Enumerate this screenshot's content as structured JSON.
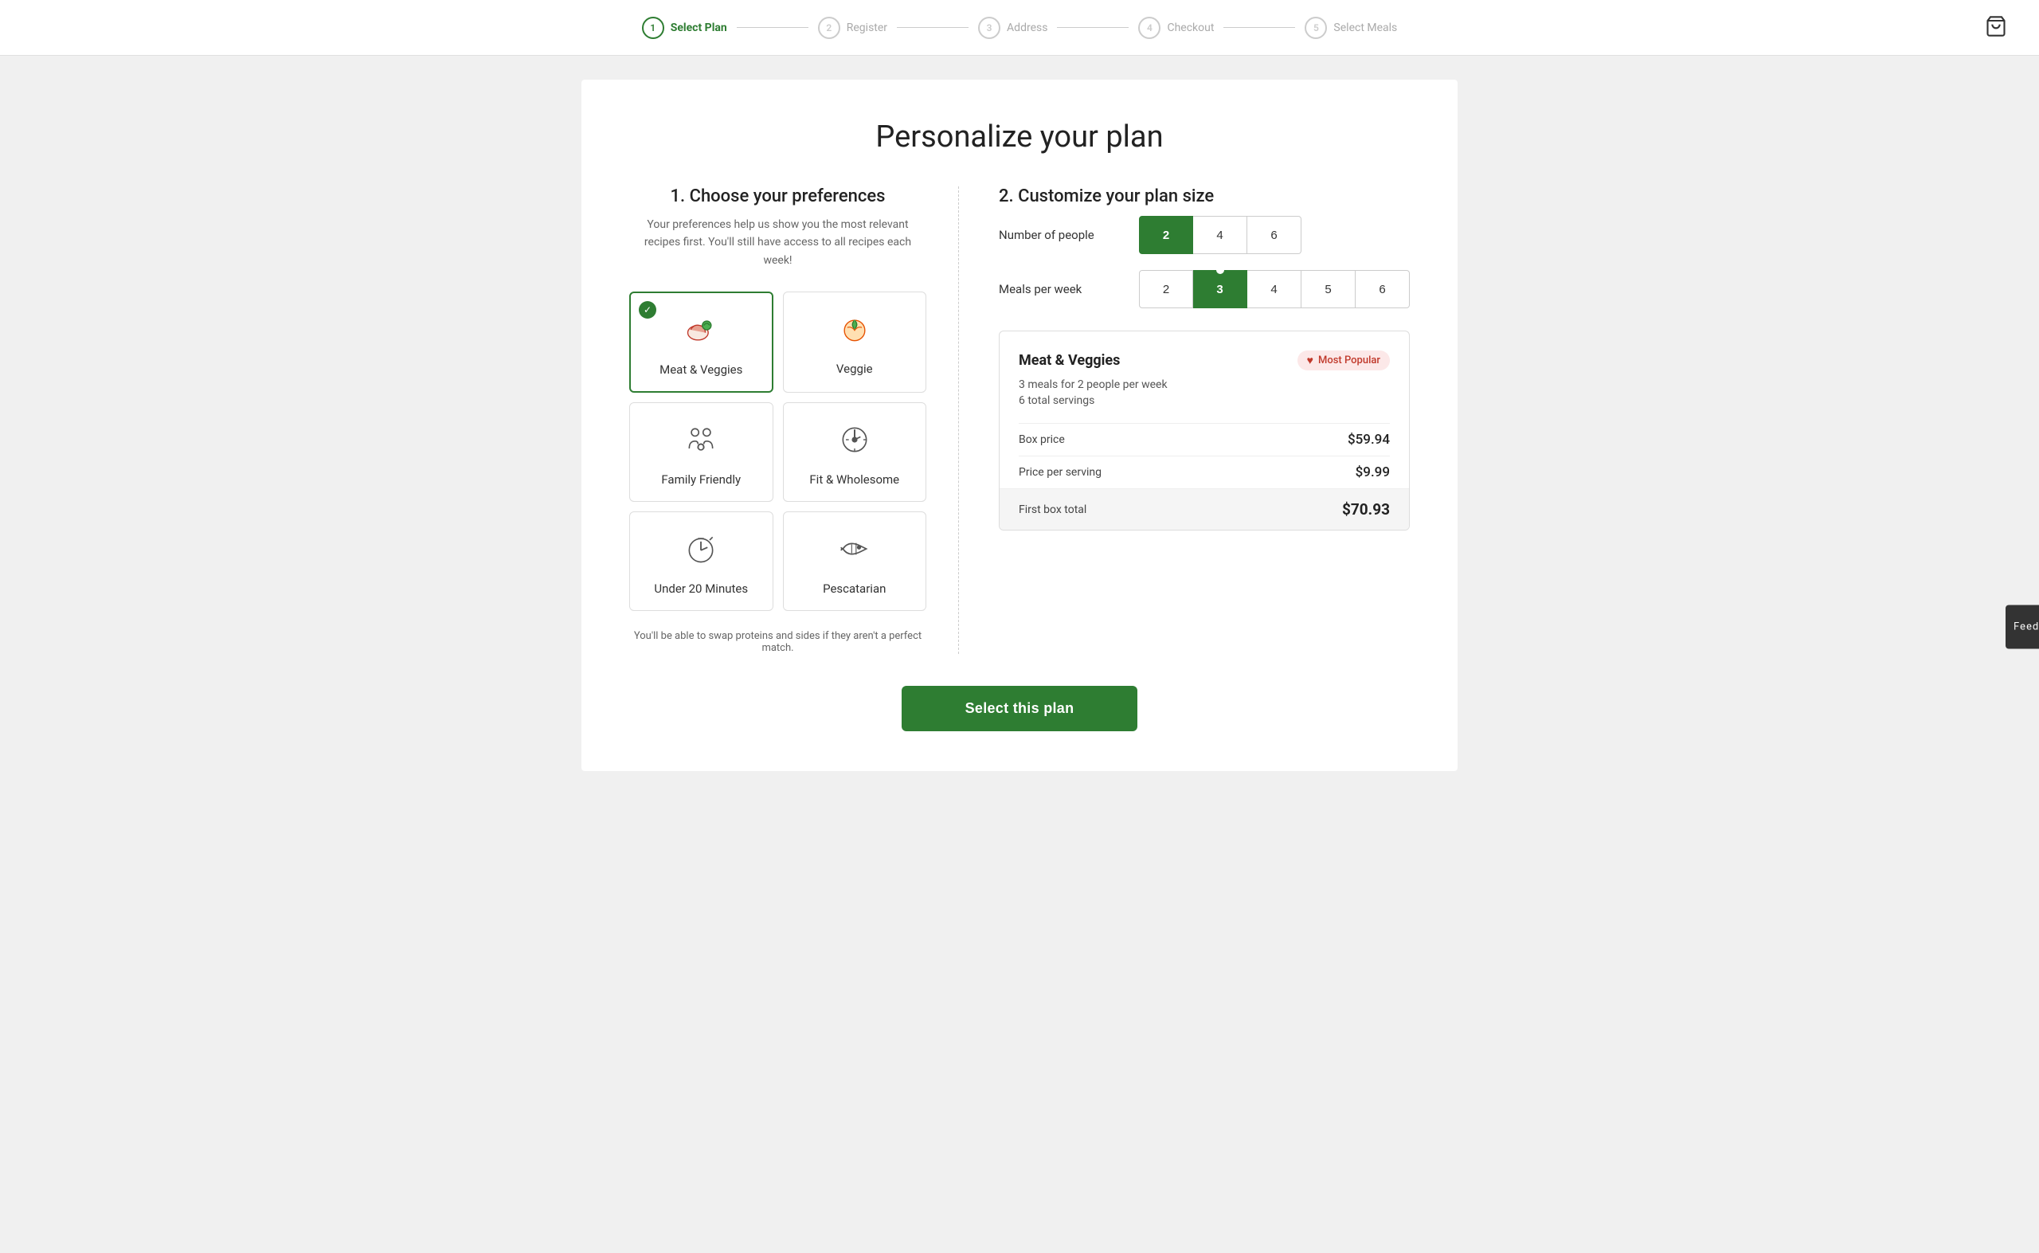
{
  "header": {
    "steps": [
      {
        "number": "1",
        "label": "Select Plan",
        "active": true
      },
      {
        "number": "2",
        "label": "Register",
        "active": false
      },
      {
        "number": "3",
        "label": "Address",
        "active": false
      },
      {
        "number": "4",
        "label": "Checkout",
        "active": false
      },
      {
        "number": "5",
        "label": "Select Meals",
        "active": false
      }
    ]
  },
  "page": {
    "title": "Personalize your plan",
    "left_section_title": "1. Choose your preferences",
    "left_section_desc": "Your preferences help us show you the most relevant recipes first. You'll still have access to all recipes each week!",
    "preferences": [
      {
        "id": "meat-veggies",
        "label": "Meat & Veggies",
        "icon": "🥩",
        "selected": true
      },
      {
        "id": "veggie",
        "label": "Veggie",
        "icon": "🍅",
        "selected": false
      },
      {
        "id": "family-friendly",
        "label": "Family Friendly",
        "icon": "👨‍👩‍👧",
        "selected": false
      },
      {
        "id": "fit-wholesome",
        "label": "Fit & Wholesome",
        "icon": "⏱️",
        "selected": false
      },
      {
        "id": "under-20",
        "label": "Under 20 Minutes",
        "icon": "⏱",
        "selected": false
      },
      {
        "id": "pescatarian",
        "label": "Pescatarian",
        "icon": "🐟",
        "selected": false
      }
    ],
    "swap_note": "You'll be able to swap proteins and sides if they aren't a perfect match.",
    "right_section_title": "2. Customize your plan size",
    "people_label": "Number of people",
    "people_options": [
      "2",
      "4",
      "6"
    ],
    "people_selected": "2",
    "meals_label": "Meals per week",
    "meals_options": [
      "2",
      "3",
      "4",
      "5",
      "6"
    ],
    "meals_selected": "3",
    "meals_popular": "3",
    "summary": {
      "plan_name": "Meat & Veggies",
      "most_popular_label": "Most Popular",
      "description": "3 meals for 2 people per week",
      "servings": "6 total servings",
      "box_price_label": "Box price",
      "box_price_value": "$59.94",
      "price_per_serving_label": "Price per serving",
      "price_per_serving_value": "$9.99",
      "first_box_label": "First box total",
      "first_box_value": "$70.93"
    },
    "select_button_label": "Select this plan"
  },
  "feedback": {
    "label": "Feedback"
  }
}
